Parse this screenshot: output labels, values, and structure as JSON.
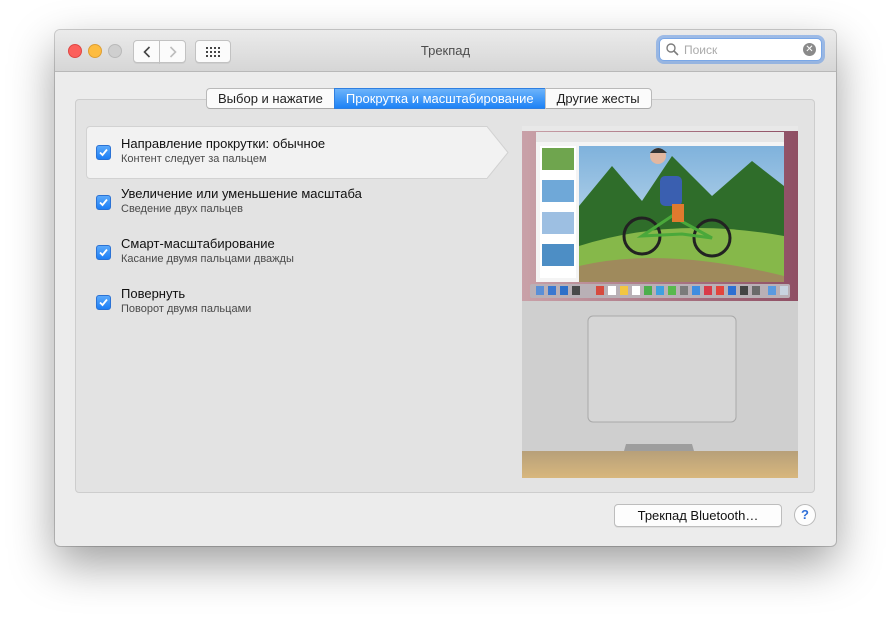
{
  "window": {
    "title": "Трекпад",
    "search": {
      "placeholder": "Поиск"
    }
  },
  "tabs": [
    {
      "label": "Выбор и нажатие",
      "active": false
    },
    {
      "label": "Прокрутка и масштабирование",
      "active": true
    },
    {
      "label": "Другие жесты",
      "active": false
    }
  ],
  "options": [
    {
      "title": "Направление прокрутки: обычное",
      "subtitle": "Контент следует за пальцем",
      "checked": true,
      "selected": true
    },
    {
      "title": "Увеличение или уменьшение масштаба",
      "subtitle": "Сведение двух пальцев",
      "checked": true,
      "selected": false
    },
    {
      "title": "Смарт-масштабирование",
      "subtitle": "Касание двумя пальцами дважды",
      "checked": true,
      "selected": false
    },
    {
      "title": "Повернуть",
      "subtitle": "Поворот двумя пальцами",
      "checked": true,
      "selected": false
    }
  ],
  "footer": {
    "bluetooth_button": "Трекпад Bluetooth…",
    "help_label": "?"
  },
  "colors": {
    "accent": "#1d82f6",
    "close": "#fc605c",
    "minimize": "#fdbc40"
  },
  "icons": [
    "close-icon",
    "minimize-icon",
    "zoom-icon",
    "chevron-left-icon",
    "chevron-right-icon",
    "grid-icon",
    "search-icon",
    "clear-icon",
    "checkmark-icon"
  ]
}
